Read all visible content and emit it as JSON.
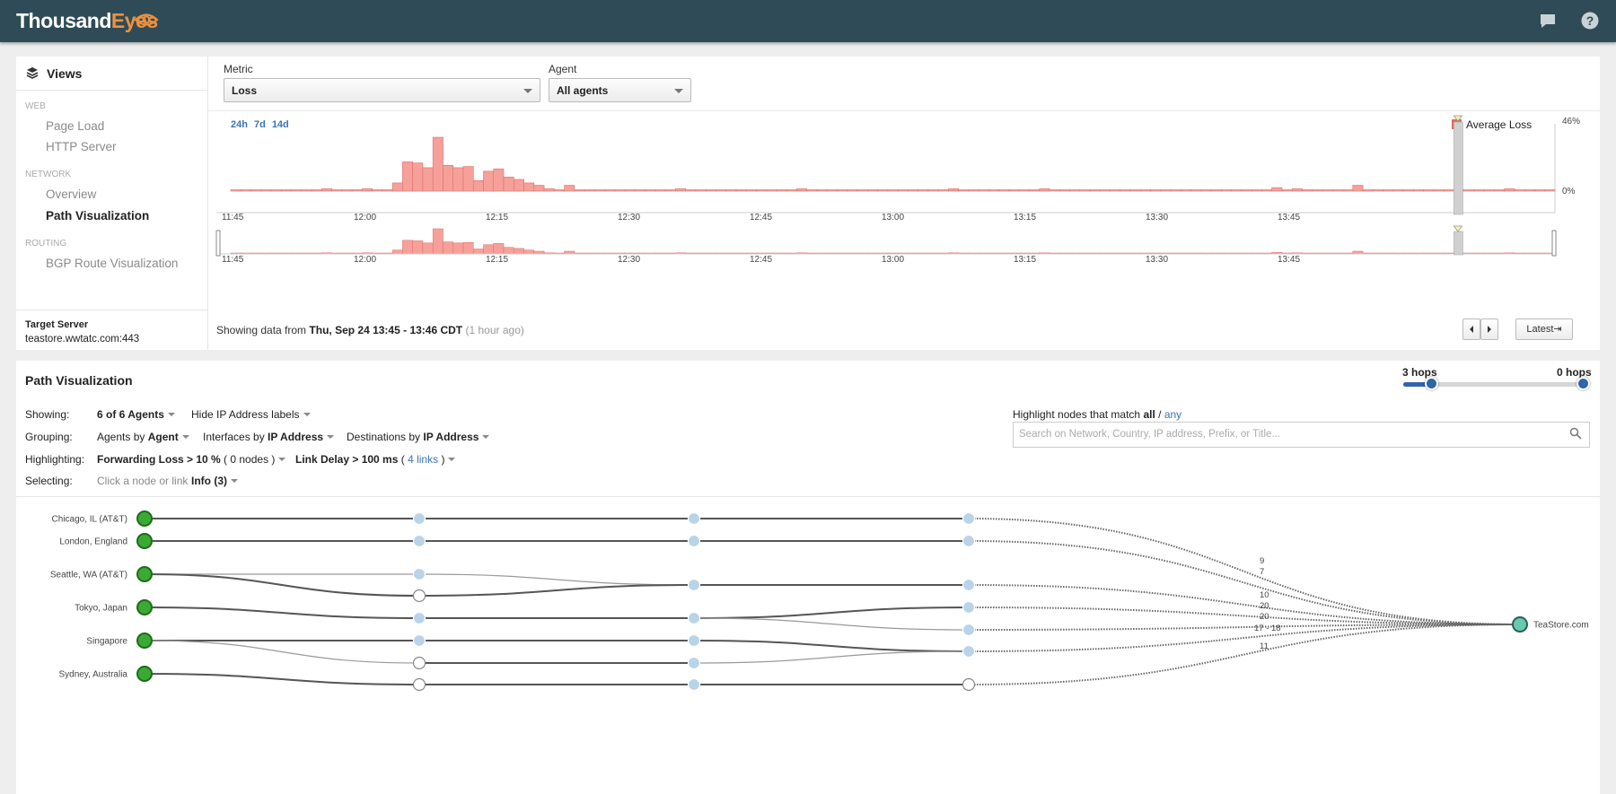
{
  "header": {
    "logo_text_white": "Thousand",
    "logo_text_orange": "Eyes",
    "icons": [
      "chat-icon",
      "help-icon"
    ]
  },
  "views": {
    "title": "Views",
    "categories": [
      {
        "name": "WEB",
        "items": [
          "Page Load",
          "HTTP Server"
        ]
      },
      {
        "name": "NETWORK",
        "items": [
          "Overview",
          "Path Visualization"
        ]
      },
      {
        "name": "ROUTING",
        "items": [
          "BGP Route Visualization"
        ]
      }
    ],
    "active_item": "Path Visualization",
    "target_label": "Target Server",
    "target_value": "teastore.wwtatc.com:443"
  },
  "metric_bar": {
    "metric_label": "Metric",
    "metric_value": "Loss",
    "agent_label": "Agent",
    "agent_value": "All agents",
    "ranges": [
      "24h",
      "7d",
      "14d"
    ]
  },
  "timeline": {
    "legend": "Average Loss",
    "y_max_label": "46%",
    "y_min_label": "0%",
    "x_labels": [
      "11:45",
      "12:00",
      "12:15",
      "12:30",
      "12:45",
      "13:00",
      "13:15",
      "13:30",
      "13:45"
    ],
    "showing_prefix": "Showing data from",
    "showing_range": "Thu, Sep 24 13:45 - 13:46 CDT",
    "showing_ago": "(1 hour ago)",
    "latest_button": "Latest⇥"
  },
  "chart_data": {
    "type": "bar",
    "title": "",
    "series": [
      {
        "name": "Average Loss",
        "values": [
          1,
          1,
          1,
          0,
          0,
          1,
          1,
          0,
          1,
          2,
          0,
          1,
          0,
          2,
          0,
          1,
          7,
          25,
          24,
          20,
          46,
          22,
          20,
          21,
          9,
          17,
          19,
          12,
          10,
          7,
          5,
          2,
          0,
          5,
          0,
          0,
          1,
          1,
          0,
          0,
          0,
          1,
          0,
          1,
          2,
          1,
          0,
          0,
          1,
          1,
          0,
          0,
          0,
          1,
          0,
          0,
          2,
          0,
          0,
          0,
          0,
          1,
          1,
          0,
          0,
          1,
          0,
          0,
          1,
          0,
          0,
          2,
          0,
          0,
          0,
          0,
          1,
          0,
          0,
          0,
          2,
          0,
          0,
          1,
          0,
          0,
          0,
          1,
          0,
          0,
          0,
          0,
          0,
          0,
          0,
          0,
          0,
          1,
          0,
          0,
          1,
          0,
          0,
          3,
          0,
          2,
          0,
          0,
          0,
          0,
          1,
          5,
          1,
          0,
          0,
          0,
          0,
          0,
          0,
          0,
          0,
          1,
          0,
          0,
          0,
          0,
          2,
          0,
          1,
          0,
          0
        ]
      }
    ],
    "x_range": [
      "11:45",
      "13:55"
    ],
    "ylim": [
      0,
      46
    ],
    "selected_time": "13:45"
  },
  "path_viz": {
    "title": "Path Visualization",
    "hops_left": "3 hops",
    "hops_right": "0 hops",
    "showing_label": "Showing:",
    "showing_value": "6 of 6 Agents",
    "hide_ip": "Hide IP Address labels",
    "grouping_label": "Grouping:",
    "grouping_agents_prefix": "Agents by",
    "grouping_agents_value": "Agent",
    "grouping_interfaces_prefix": "Interfaces by",
    "grouping_interfaces_value": "IP Address",
    "grouping_dest_prefix": "Destinations by",
    "grouping_dest_value": "IP Address",
    "highlighting_label": "Highlighting:",
    "fwd_loss": "Forwarding Loss > 10 %",
    "fwd_loss_count": "( 0 nodes )",
    "link_delay": "Link Delay > 100 ms",
    "link_delay_open": "(",
    "link_delay_count": "4 links",
    "link_delay_close": ")",
    "selecting_label": "Selecting:",
    "selecting_hint": "Click a node or link",
    "selecting_info": "Info (3)",
    "highlight_match_prefix": "Highlight nodes that match",
    "highlight_all": "all",
    "highlight_sep": "/",
    "highlight_any": "any",
    "search_placeholder": "Search on Network, Country, IP address, Prefix, or Title...",
    "agents": [
      "Chicago, IL (AT&T)",
      "London, England",
      "Seattle, WA (AT&T)",
      "Tokyo, Japan",
      "Singapore",
      "Sydney, Australia"
    ],
    "destination": "TeaStore.com",
    "link_labels": [
      "9",
      "7",
      "10",
      "20",
      "20",
      "17 - 18",
      "11"
    ],
    "colors": {
      "agent_node": "#3aaa35",
      "hop_node": "#b9d3e8",
      "destination_node": "#69c8b0",
      "bar": "#f7a09a",
      "header": "#2f4b57"
    }
  }
}
